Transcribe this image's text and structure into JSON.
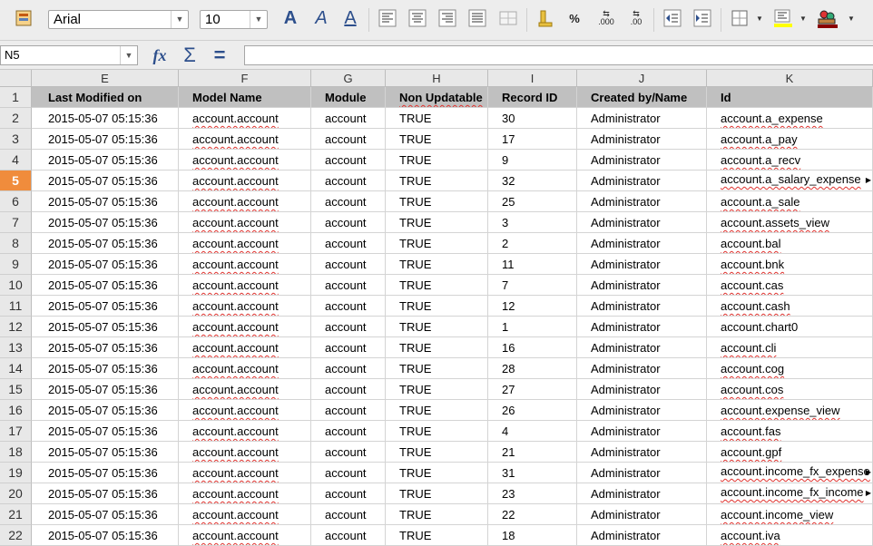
{
  "toolbar": {
    "font_name": "Arial",
    "font_size": "10",
    "icons": [
      "styles-icon",
      "bold-a-icon",
      "italic-a-icon",
      "underline-a-icon",
      "align-left-icon",
      "align-center-icon",
      "align-right-icon",
      "justify-icon",
      "merge-cells-icon",
      "currency-icon",
      "percent-icon",
      "add-decimal-icon",
      "delete-decimal-icon",
      "decrease-indent-icon",
      "increase-indent-icon",
      "borders-icon",
      "highlight-color-icon",
      "font-color-icon"
    ],
    "percent_glyph": "%",
    "add_decimal_text": ".000",
    "delete_decimal_text": ".00"
  },
  "formula_bar": {
    "cell_ref": "N5",
    "fx_glyph": "fx",
    "sum_glyph": "Σ",
    "equals_glyph": "=",
    "content": ""
  },
  "columns": [
    "E",
    "F",
    "G",
    "H",
    "I",
    "J",
    "K"
  ],
  "active_row": "5",
  "header_row": {
    "row_number": "1",
    "cells": [
      "Last Modified on",
      "Model Name",
      "Module",
      "Non Updatable",
      "Record ID",
      "Created by/Name",
      "Id"
    ]
  },
  "rows": [
    {
      "n": "2",
      "modified": "2015-05-07 05:15:36",
      "model": "account.account",
      "module": "account",
      "nonupd": "TRUE",
      "rid": "30",
      "creator": "Administrator",
      "id": "account.a_expense"
    },
    {
      "n": "3",
      "modified": "2015-05-07 05:15:36",
      "model": "account.account",
      "module": "account",
      "nonupd": "TRUE",
      "rid": "17",
      "creator": "Administrator",
      "id": "account.a_pay"
    },
    {
      "n": "4",
      "modified": "2015-05-07 05:15:36",
      "model": "account.account",
      "module": "account",
      "nonupd": "TRUE",
      "rid": "9",
      "creator": "Administrator",
      "id": "account.a_recv"
    },
    {
      "n": "5",
      "modified": "2015-05-07 05:15:36",
      "model": "account.account",
      "module": "account",
      "nonupd": "TRUE",
      "rid": "32",
      "creator": "Administrator",
      "id": "account.a_salary_expense"
    },
    {
      "n": "6",
      "modified": "2015-05-07 05:15:36",
      "model": "account.account",
      "module": "account",
      "nonupd": "TRUE",
      "rid": "25",
      "creator": "Administrator",
      "id": "account.a_sale"
    },
    {
      "n": "7",
      "modified": "2015-05-07 05:15:36",
      "model": "account.account",
      "module": "account",
      "nonupd": "TRUE",
      "rid": "3",
      "creator": "Administrator",
      "id": "account.assets_view"
    },
    {
      "n": "8",
      "modified": "2015-05-07 05:15:36",
      "model": "account.account",
      "module": "account",
      "nonupd": "TRUE",
      "rid": "2",
      "creator": "Administrator",
      "id": "account.bal"
    },
    {
      "n": "9",
      "modified": "2015-05-07 05:15:36",
      "model": "account.account",
      "module": "account",
      "nonupd": "TRUE",
      "rid": "11",
      "creator": "Administrator",
      "id": "account.bnk"
    },
    {
      "n": "10",
      "modified": "2015-05-07 05:15:36",
      "model": "account.account",
      "module": "account",
      "nonupd": "TRUE",
      "rid": "7",
      "creator": "Administrator",
      "id": "account.cas"
    },
    {
      "n": "11",
      "modified": "2015-05-07 05:15:36",
      "model": "account.account",
      "module": "account",
      "nonupd": "TRUE",
      "rid": "12",
      "creator": "Administrator",
      "id": "account.cash"
    },
    {
      "n": "12",
      "modified": "2015-05-07 05:15:36",
      "model": "account.account",
      "module": "account",
      "nonupd": "TRUE",
      "rid": "1",
      "creator": "Administrator",
      "id": "account.chart0"
    },
    {
      "n": "13",
      "modified": "2015-05-07 05:15:36",
      "model": "account.account",
      "module": "account",
      "nonupd": "TRUE",
      "rid": "16",
      "creator": "Administrator",
      "id": "account.cli"
    },
    {
      "n": "14",
      "modified": "2015-05-07 05:15:36",
      "model": "account.account",
      "module": "account",
      "nonupd": "TRUE",
      "rid": "28",
      "creator": "Administrator",
      "id": "account.cog"
    },
    {
      "n": "15",
      "modified": "2015-05-07 05:15:36",
      "model": "account.account",
      "module": "account",
      "nonupd": "TRUE",
      "rid": "27",
      "creator": "Administrator",
      "id": "account.cos"
    },
    {
      "n": "16",
      "modified": "2015-05-07 05:15:36",
      "model": "account.account",
      "module": "account",
      "nonupd": "TRUE",
      "rid": "26",
      "creator": "Administrator",
      "id": "account.expense_view"
    },
    {
      "n": "17",
      "modified": "2015-05-07 05:15:36",
      "model": "account.account",
      "module": "account",
      "nonupd": "TRUE",
      "rid": "4",
      "creator": "Administrator",
      "id": "account.fas"
    },
    {
      "n": "18",
      "modified": "2015-05-07 05:15:36",
      "model": "account.account",
      "module": "account",
      "nonupd": "TRUE",
      "rid": "21",
      "creator": "Administrator",
      "id": "account.gpf"
    },
    {
      "n": "19",
      "modified": "2015-05-07 05:15:36",
      "model": "account.account",
      "module": "account",
      "nonupd": "TRUE",
      "rid": "31",
      "creator": "Administrator",
      "id": "account.income_fx_expense"
    },
    {
      "n": "20",
      "modified": "2015-05-07 05:15:36",
      "model": "account.account",
      "module": "account",
      "nonupd": "TRUE",
      "rid": "23",
      "creator": "Administrator",
      "id": "account.income_fx_income"
    },
    {
      "n": "21",
      "modified": "2015-05-07 05:15:36",
      "model": "account.account",
      "module": "account",
      "nonupd": "TRUE",
      "rid": "22",
      "creator": "Administrator",
      "id": "account.income_view"
    },
    {
      "n": "22",
      "modified": "2015-05-07 05:15:36",
      "model": "account.account",
      "module": "account",
      "nonupd": "TRUE",
      "rid": "18",
      "creator": "Administrator",
      "id": "account.iva"
    }
  ],
  "colors": {
    "active_row_header": "#f08c3c",
    "header_fill": "#c0c0c0",
    "spell_underline": "#e0322e",
    "icon_blue": "#2d4f8c"
  }
}
